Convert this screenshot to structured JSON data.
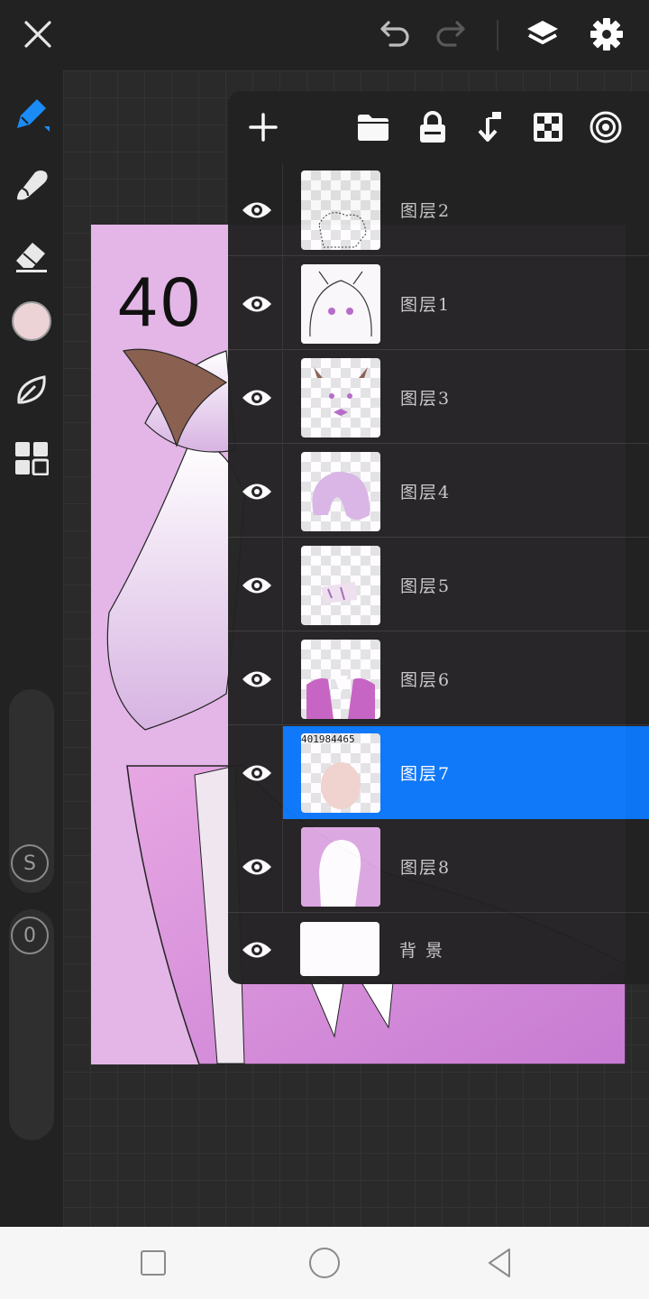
{
  "artwork": {
    "overlay_number": "40"
  },
  "layers": [
    {
      "name": "图层2",
      "selected": false
    },
    {
      "name": "图层1",
      "selected": false
    },
    {
      "name": "图层3",
      "selected": false
    },
    {
      "name": "图层4",
      "selected": false
    },
    {
      "name": "图层5",
      "selected": false
    },
    {
      "name": "图层6",
      "selected": false
    },
    {
      "name": "图层7",
      "selected": true,
      "thumb_text": "401984465"
    },
    {
      "name": "图层8",
      "selected": false
    },
    {
      "name": "背 景",
      "selected": false
    }
  ],
  "slider_labels": {
    "size": "S",
    "opacity": "0"
  },
  "colors": {
    "accent": "#0a78fa",
    "current_color": "#ecd3d6",
    "canvas_bg": "#e2b4e6"
  },
  "icons": [
    "close-icon",
    "undo-icon",
    "redo-icon",
    "layers-icon",
    "gear-icon",
    "pen-icon",
    "smudge-icon",
    "eraser-icon",
    "color-swatch",
    "leaf-icon",
    "grid-icon",
    "plus-icon",
    "folder-icon",
    "lock-icon",
    "merge-down-icon",
    "transparency-icon",
    "blend-icon",
    "eye-icon",
    "square-icon",
    "circle-icon",
    "back-icon"
  ]
}
